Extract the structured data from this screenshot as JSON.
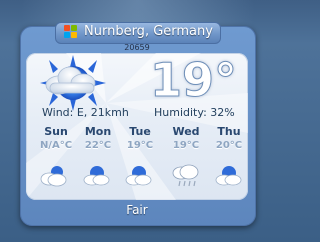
{
  "location": {
    "name": "Nurnberg, Germany",
    "code": "20659"
  },
  "current": {
    "temperature": "19°",
    "wind": "Wind: E, 21kmh",
    "humidity": "Humidity: 32%",
    "icon": "sun-partly-cloudy-icon",
    "condition": "Fair"
  },
  "forecast": [
    {
      "day": "Sun",
      "temp": "N/A°C",
      "icon": "partly-cloudy-icon"
    },
    {
      "day": "Mon",
      "temp": "22°C",
      "icon": "partly-cloudy-icon"
    },
    {
      "day": "Tue",
      "temp": "19°C",
      "icon": "partly-cloudy-icon"
    },
    {
      "day": "Wed",
      "temp": "19°C",
      "icon": "cloud-rain-icon"
    },
    {
      "day": "Thu",
      "temp": "20°C",
      "icon": "partly-cloudy-icon"
    }
  ],
  "colors": {
    "frame": "#5d86bd",
    "panel": "#eef3f9",
    "text": "#24415f",
    "sun": "#1f5fd6"
  }
}
